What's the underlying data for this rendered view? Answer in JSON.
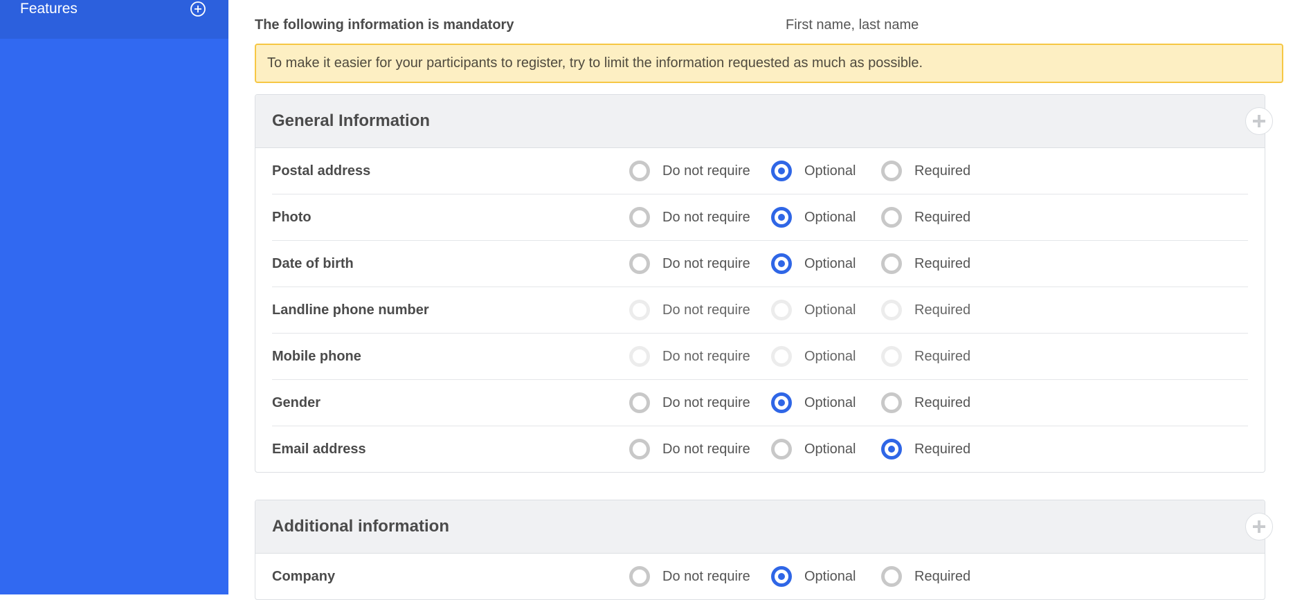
{
  "sidebar": {
    "active_item": {
      "label": "Features",
      "icon": "plus-circle-icon"
    }
  },
  "mandatory": {
    "label": "The following information is mandatory",
    "value": "First name, last name"
  },
  "notice": {
    "text": "To make it easier for your participants to register, try to limit the information requested as much as possible."
  },
  "options": {
    "do_not_require": "Do not require",
    "optional": "Optional",
    "required": "Required"
  },
  "sections": [
    {
      "title": "General Information",
      "toggle_icon": "plus-icon",
      "rows": [
        {
          "label": "Postal address",
          "selected": "optional",
          "disabled": false
        },
        {
          "label": "Photo",
          "selected": "optional",
          "disabled": false
        },
        {
          "label": "Date of birth",
          "selected": "optional",
          "disabled": false
        },
        {
          "label": "Landline phone number",
          "selected": "",
          "disabled": true
        },
        {
          "label": "Mobile phone",
          "selected": "",
          "disabled": true
        },
        {
          "label": "Gender",
          "selected": "optional",
          "disabled": false
        },
        {
          "label": "Email address",
          "selected": "required",
          "disabled": false
        }
      ]
    },
    {
      "title": "Additional information",
      "toggle_icon": "plus-icon",
      "rows": [
        {
          "label": "Company",
          "selected": "optional",
          "disabled": false
        }
      ]
    }
  ],
  "colors": {
    "sidebar": "#3169f1",
    "accent": "#2f66e6",
    "notice_bg": "#fdefc3",
    "notice_border": "#f6c744"
  }
}
